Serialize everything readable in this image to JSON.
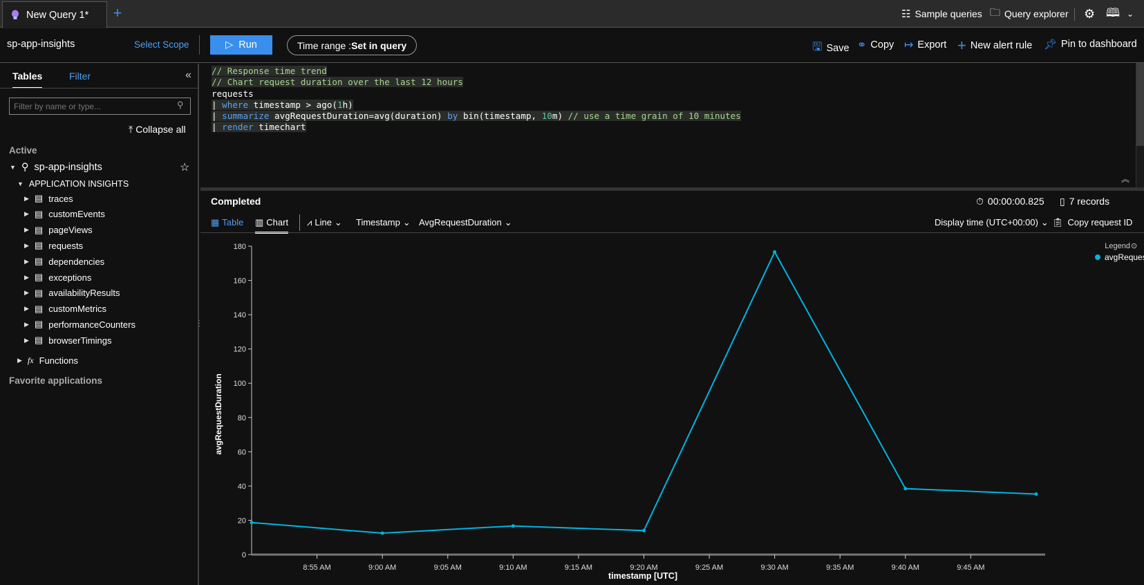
{
  "tabs": [
    {
      "label": "New Query 1*",
      "icon": "lightbulb-icon"
    }
  ],
  "top_actions": {
    "sample_queries": "Sample queries",
    "query_explorer": "Query explorer"
  },
  "toolbar": {
    "scope": "sp-app-insights",
    "select_scope": "Select Scope",
    "run": "Run",
    "time_range_label": "Time range : ",
    "time_range_value": "Set in query",
    "save": "Save",
    "copy": "Copy",
    "export": "Export",
    "new_alert": "New alert rule",
    "pin": "Pin to dashboard"
  },
  "sidebar": {
    "tab_tables": "Tables",
    "tab_filter": "Filter",
    "filter_placeholder": "Filter by name or type...",
    "collapse_all": "Collapse all",
    "active_label": "Active",
    "resource": "sp-app-insights",
    "group": "APPLICATION INSIGHTS",
    "tables": [
      "traces",
      "customEvents",
      "pageViews",
      "requests",
      "dependencies",
      "exceptions",
      "availabilityResults",
      "customMetrics",
      "performanceCounters",
      "browserTimings"
    ],
    "functions": "Functions",
    "favorites": "Favorite applications"
  },
  "editor": {
    "lines": [
      [
        {
          "t": "// Response time trend",
          "c": "cm"
        }
      ],
      [
        {
          "t": "// Chart request duration over the last 12 hours",
          "c": "cm"
        }
      ],
      [
        {
          "t": "requests",
          "c": ""
        }
      ],
      [
        {
          "t": "| ",
          "c": ""
        },
        {
          "t": "where",
          "c": "kw"
        },
        {
          "t": " timestamp > ago(",
          "c": ""
        },
        {
          "t": "1",
          "c": "nm"
        },
        {
          "t": "h)",
          "c": ""
        }
      ],
      [
        {
          "t": "| ",
          "c": ""
        },
        {
          "t": "summarize",
          "c": "kw"
        },
        {
          "t": " avgRequestDuration=avg(duration) ",
          "c": ""
        },
        {
          "t": "by",
          "c": "kw"
        },
        {
          "t": " bin(timestamp, ",
          "c": ""
        },
        {
          "t": "10",
          "c": "nm"
        },
        {
          "t": "m) ",
          "c": ""
        },
        {
          "t": "// use a time grain of 10 minutes",
          "c": "cm"
        }
      ],
      [
        {
          "t": "| ",
          "c": ""
        },
        {
          "t": "render",
          "c": "kw"
        },
        {
          "t": " timechart",
          "c": ""
        }
      ]
    ]
  },
  "results": {
    "status": "Completed",
    "duration": "00:00:00.825",
    "records": "7 records",
    "tab_table": "Table",
    "tab_chart": "Chart",
    "chart_type": "Line",
    "x_column": "Timestamp",
    "y_column": "AvgRequestDuration",
    "display_time": "Display time (UTC+00:00)",
    "copy_request_id": "Copy request ID"
  },
  "colors": {
    "accent": "#3a8eed",
    "series": "#00b4e0"
  },
  "chart_data": {
    "type": "line",
    "xlabel": "timestamp [UTC]",
    "ylabel": "avgRequestDuration",
    "x": [
      "8:50",
      "9:00",
      "9:10",
      "9:20",
      "9:30",
      "9:40",
      "9:50"
    ],
    "series": [
      {
        "name": "avgRequestDuration",
        "values": [
          18.7,
          12.5,
          16.7,
          14.0,
          176.6,
          38.5,
          35.3
        ]
      }
    ],
    "xticks": [
      "8:55 AM",
      "9:00 AM",
      "9:05 AM",
      "9:10 AM",
      "9:15 AM",
      "9:20 AM",
      "9:25 AM",
      "9:30 AM",
      "9:35 AM",
      "9:40 AM",
      "9:45 AM"
    ],
    "yticks": [
      0,
      20,
      40,
      60,
      80,
      100,
      120,
      140,
      160,
      180
    ],
    "ylim": [
      0,
      180
    ],
    "legend_title": "Legend",
    "legend_position": "top-right",
    "grid": false
  }
}
